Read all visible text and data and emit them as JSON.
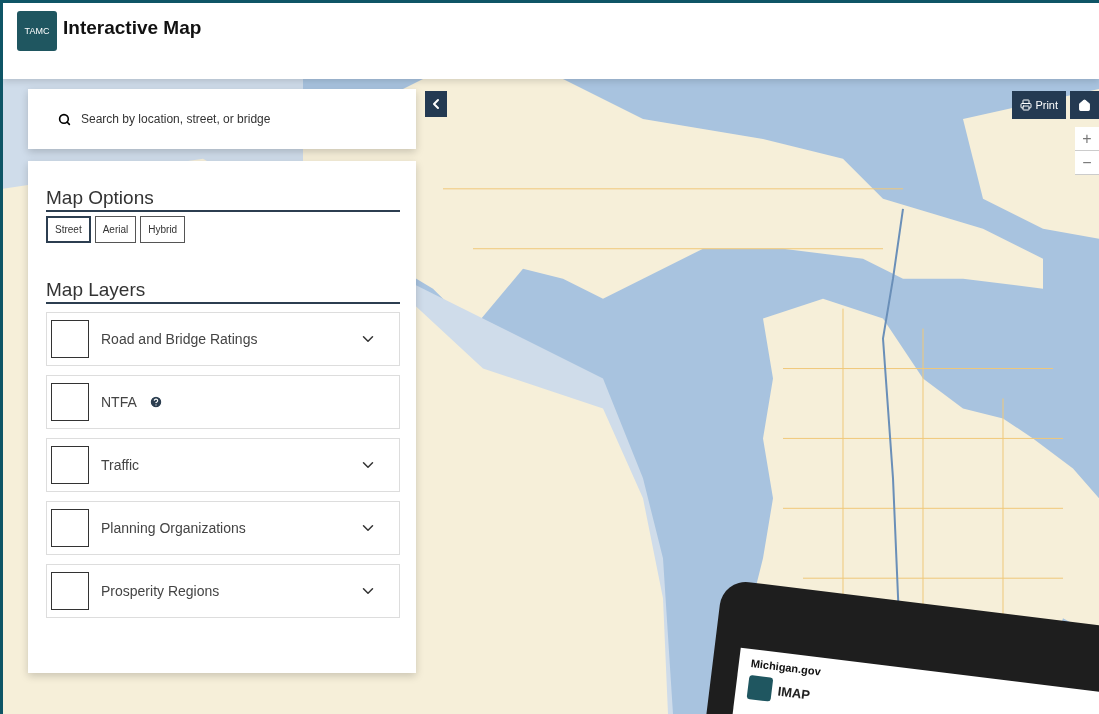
{
  "header": {
    "logo_text": "TAMC",
    "title": "Interactive Map"
  },
  "search": {
    "placeholder": "Search by location, street, or bridge"
  },
  "map_options": {
    "heading": "Map Options",
    "types": [
      {
        "label": "Street",
        "selected": true
      },
      {
        "label": "Aerial",
        "selected": false
      },
      {
        "label": "Hybrid",
        "selected": false
      }
    ]
  },
  "map_layers": {
    "heading": "Map Layers",
    "items": [
      {
        "label": "Road and Bridge Ratings",
        "checked": false,
        "kind": "expandable"
      },
      {
        "label": "NTFA",
        "checked": false,
        "kind": "info"
      },
      {
        "label": "Traffic",
        "checked": false,
        "kind": "expandable"
      },
      {
        "label": "Planning Organizations",
        "checked": false,
        "kind": "expandable"
      },
      {
        "label": "Prosperity Regions",
        "checked": false,
        "kind": "expandable"
      }
    ]
  },
  "map_controls": {
    "print": "Print",
    "zoom_in": "+",
    "zoom_out": "−"
  },
  "tablet": {
    "site": "Michigan.gov",
    "app": "IMAP"
  }
}
